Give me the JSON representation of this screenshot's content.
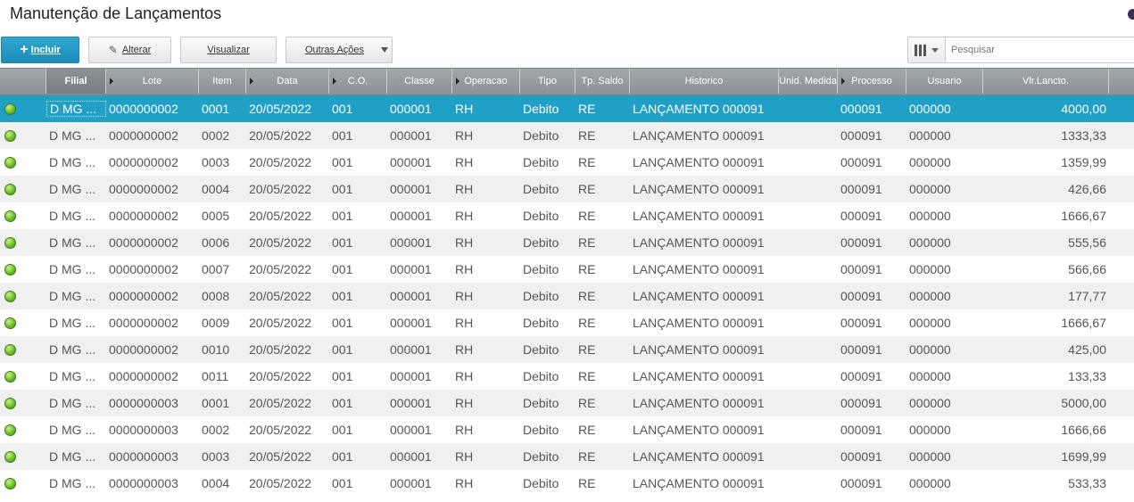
{
  "page": {
    "title": "Manutenção de Lançamentos"
  },
  "toolbar": {
    "incluir": "Incluir",
    "alterar": "Alterar",
    "visualizar": "Visualizar",
    "outras_acoes": "Outras Ações"
  },
  "search": {
    "placeholder": "Pesquisar",
    "value": ""
  },
  "colors": {
    "accent": "#20a0c7",
    "header": "#8e969a",
    "status_ok": "#6fbf2a"
  },
  "table": {
    "columns": [
      "",
      "Filial",
      "Lote",
      "Item",
      "Data",
      "C.O.",
      "Classe",
      "Operacao",
      "Tipo",
      "Tp. Saldo",
      "Historico",
      "Unid. Medida",
      "Processo",
      "Usuario",
      "Vlr.Lancto."
    ],
    "rows": [
      {
        "status": "green",
        "filial": "D MG ...",
        "lote": "0000000002",
        "item": "0001",
        "data": "20/05/2022",
        "co": "001",
        "classe": "000001",
        "operacao": "RH",
        "tipo": "Debito",
        "tp_saldo": "RE",
        "historico": "LANÇAMENTO 000091",
        "unid_medida": "",
        "processo": "000091",
        "usuario": "000000",
        "valor": "4000,00"
      },
      {
        "status": "green",
        "filial": "D MG ...",
        "lote": "0000000002",
        "item": "0002",
        "data": "20/05/2022",
        "co": "001",
        "classe": "000001",
        "operacao": "RH",
        "tipo": "Debito",
        "tp_saldo": "RE",
        "historico": "LANÇAMENTO 000091",
        "unid_medida": "",
        "processo": "000091",
        "usuario": "000000",
        "valor": "1333,33"
      },
      {
        "status": "green",
        "filial": "D MG ...",
        "lote": "0000000002",
        "item": "0003",
        "data": "20/05/2022",
        "co": "001",
        "classe": "000001",
        "operacao": "RH",
        "tipo": "Debito",
        "tp_saldo": "RE",
        "historico": "LANÇAMENTO 000091",
        "unid_medida": "",
        "processo": "000091",
        "usuario": "000000",
        "valor": "1359,99"
      },
      {
        "status": "green",
        "filial": "D MG ...",
        "lote": "0000000002",
        "item": "0004",
        "data": "20/05/2022",
        "co": "001",
        "classe": "000001",
        "operacao": "RH",
        "tipo": "Debito",
        "tp_saldo": "RE",
        "historico": "LANÇAMENTO 000091",
        "unid_medida": "",
        "processo": "000091",
        "usuario": "000000",
        "valor": "426,66"
      },
      {
        "status": "green",
        "filial": "D MG ...",
        "lote": "0000000002",
        "item": "0005",
        "data": "20/05/2022",
        "co": "001",
        "classe": "000001",
        "operacao": "RH",
        "tipo": "Debito",
        "tp_saldo": "RE",
        "historico": "LANÇAMENTO 000091",
        "unid_medida": "",
        "processo": "000091",
        "usuario": "000000",
        "valor": "1666,67"
      },
      {
        "status": "green",
        "filial": "D MG ...",
        "lote": "0000000002",
        "item": "0006",
        "data": "20/05/2022",
        "co": "001",
        "classe": "000001",
        "operacao": "RH",
        "tipo": "Debito",
        "tp_saldo": "RE",
        "historico": "LANÇAMENTO 000091",
        "unid_medida": "",
        "processo": "000091",
        "usuario": "000000",
        "valor": "555,56"
      },
      {
        "status": "green",
        "filial": "D MG ...",
        "lote": "0000000002",
        "item": "0007",
        "data": "20/05/2022",
        "co": "001",
        "classe": "000001",
        "operacao": "RH",
        "tipo": "Debito",
        "tp_saldo": "RE",
        "historico": "LANÇAMENTO 000091",
        "unid_medida": "",
        "processo": "000091",
        "usuario": "000000",
        "valor": "566,66"
      },
      {
        "status": "green",
        "filial": "D MG ...",
        "lote": "0000000002",
        "item": "0008",
        "data": "20/05/2022",
        "co": "001",
        "classe": "000001",
        "operacao": "RH",
        "tipo": "Debito",
        "tp_saldo": "RE",
        "historico": "LANÇAMENTO 000091",
        "unid_medida": "",
        "processo": "000091",
        "usuario": "000000",
        "valor": "177,77"
      },
      {
        "status": "green",
        "filial": "D MG ...",
        "lote": "0000000002",
        "item": "0009",
        "data": "20/05/2022",
        "co": "001",
        "classe": "000001",
        "operacao": "RH",
        "tipo": "Debito",
        "tp_saldo": "RE",
        "historico": "LANÇAMENTO 000091",
        "unid_medida": "",
        "processo": "000091",
        "usuario": "000000",
        "valor": "1666,67"
      },
      {
        "status": "green",
        "filial": "D MG ...",
        "lote": "0000000002",
        "item": "0010",
        "data": "20/05/2022",
        "co": "001",
        "classe": "000001",
        "operacao": "RH",
        "tipo": "Debito",
        "tp_saldo": "RE",
        "historico": "LANÇAMENTO 000091",
        "unid_medida": "",
        "processo": "000091",
        "usuario": "000000",
        "valor": "425,00"
      },
      {
        "status": "green",
        "filial": "D MG ...",
        "lote": "0000000002",
        "item": "0011",
        "data": "20/05/2022",
        "co": "001",
        "classe": "000001",
        "operacao": "RH",
        "tipo": "Debito",
        "tp_saldo": "RE",
        "historico": "LANÇAMENTO 000091",
        "unid_medida": "",
        "processo": "000091",
        "usuario": "000000",
        "valor": "133,33"
      },
      {
        "status": "green",
        "filial": "D MG ...",
        "lote": "0000000003",
        "item": "0001",
        "data": "20/05/2022",
        "co": "001",
        "classe": "000001",
        "operacao": "RH",
        "tipo": "Debito",
        "tp_saldo": "RE",
        "historico": "LANÇAMENTO 000091",
        "unid_medida": "",
        "processo": "000091",
        "usuario": "000000",
        "valor": "5000,00"
      },
      {
        "status": "green",
        "filial": "D MG ...",
        "lote": "0000000003",
        "item": "0002",
        "data": "20/05/2022",
        "co": "001",
        "classe": "000001",
        "operacao": "RH",
        "tipo": "Debito",
        "tp_saldo": "RE",
        "historico": "LANÇAMENTO 000091",
        "unid_medida": "",
        "processo": "000091",
        "usuario": "000000",
        "valor": "1666,66"
      },
      {
        "status": "green",
        "filial": "D MG ...",
        "lote": "0000000003",
        "item": "0003",
        "data": "20/05/2022",
        "co": "001",
        "classe": "000001",
        "operacao": "RH",
        "tipo": "Debito",
        "tp_saldo": "RE",
        "historico": "LANÇAMENTO 000091",
        "unid_medida": "",
        "processo": "000091",
        "usuario": "000000",
        "valor": "1699,99"
      },
      {
        "status": "green",
        "filial": "D MG ...",
        "lote": "0000000003",
        "item": "0004",
        "data": "20/05/2022",
        "co": "001",
        "classe": "000001",
        "operacao": "RH",
        "tipo": "Debito",
        "tp_saldo": "RE",
        "historico": "LANÇAMENTO 000091",
        "unid_medida": "",
        "processo": "000091",
        "usuario": "000000",
        "valor": "533,33"
      }
    ]
  }
}
